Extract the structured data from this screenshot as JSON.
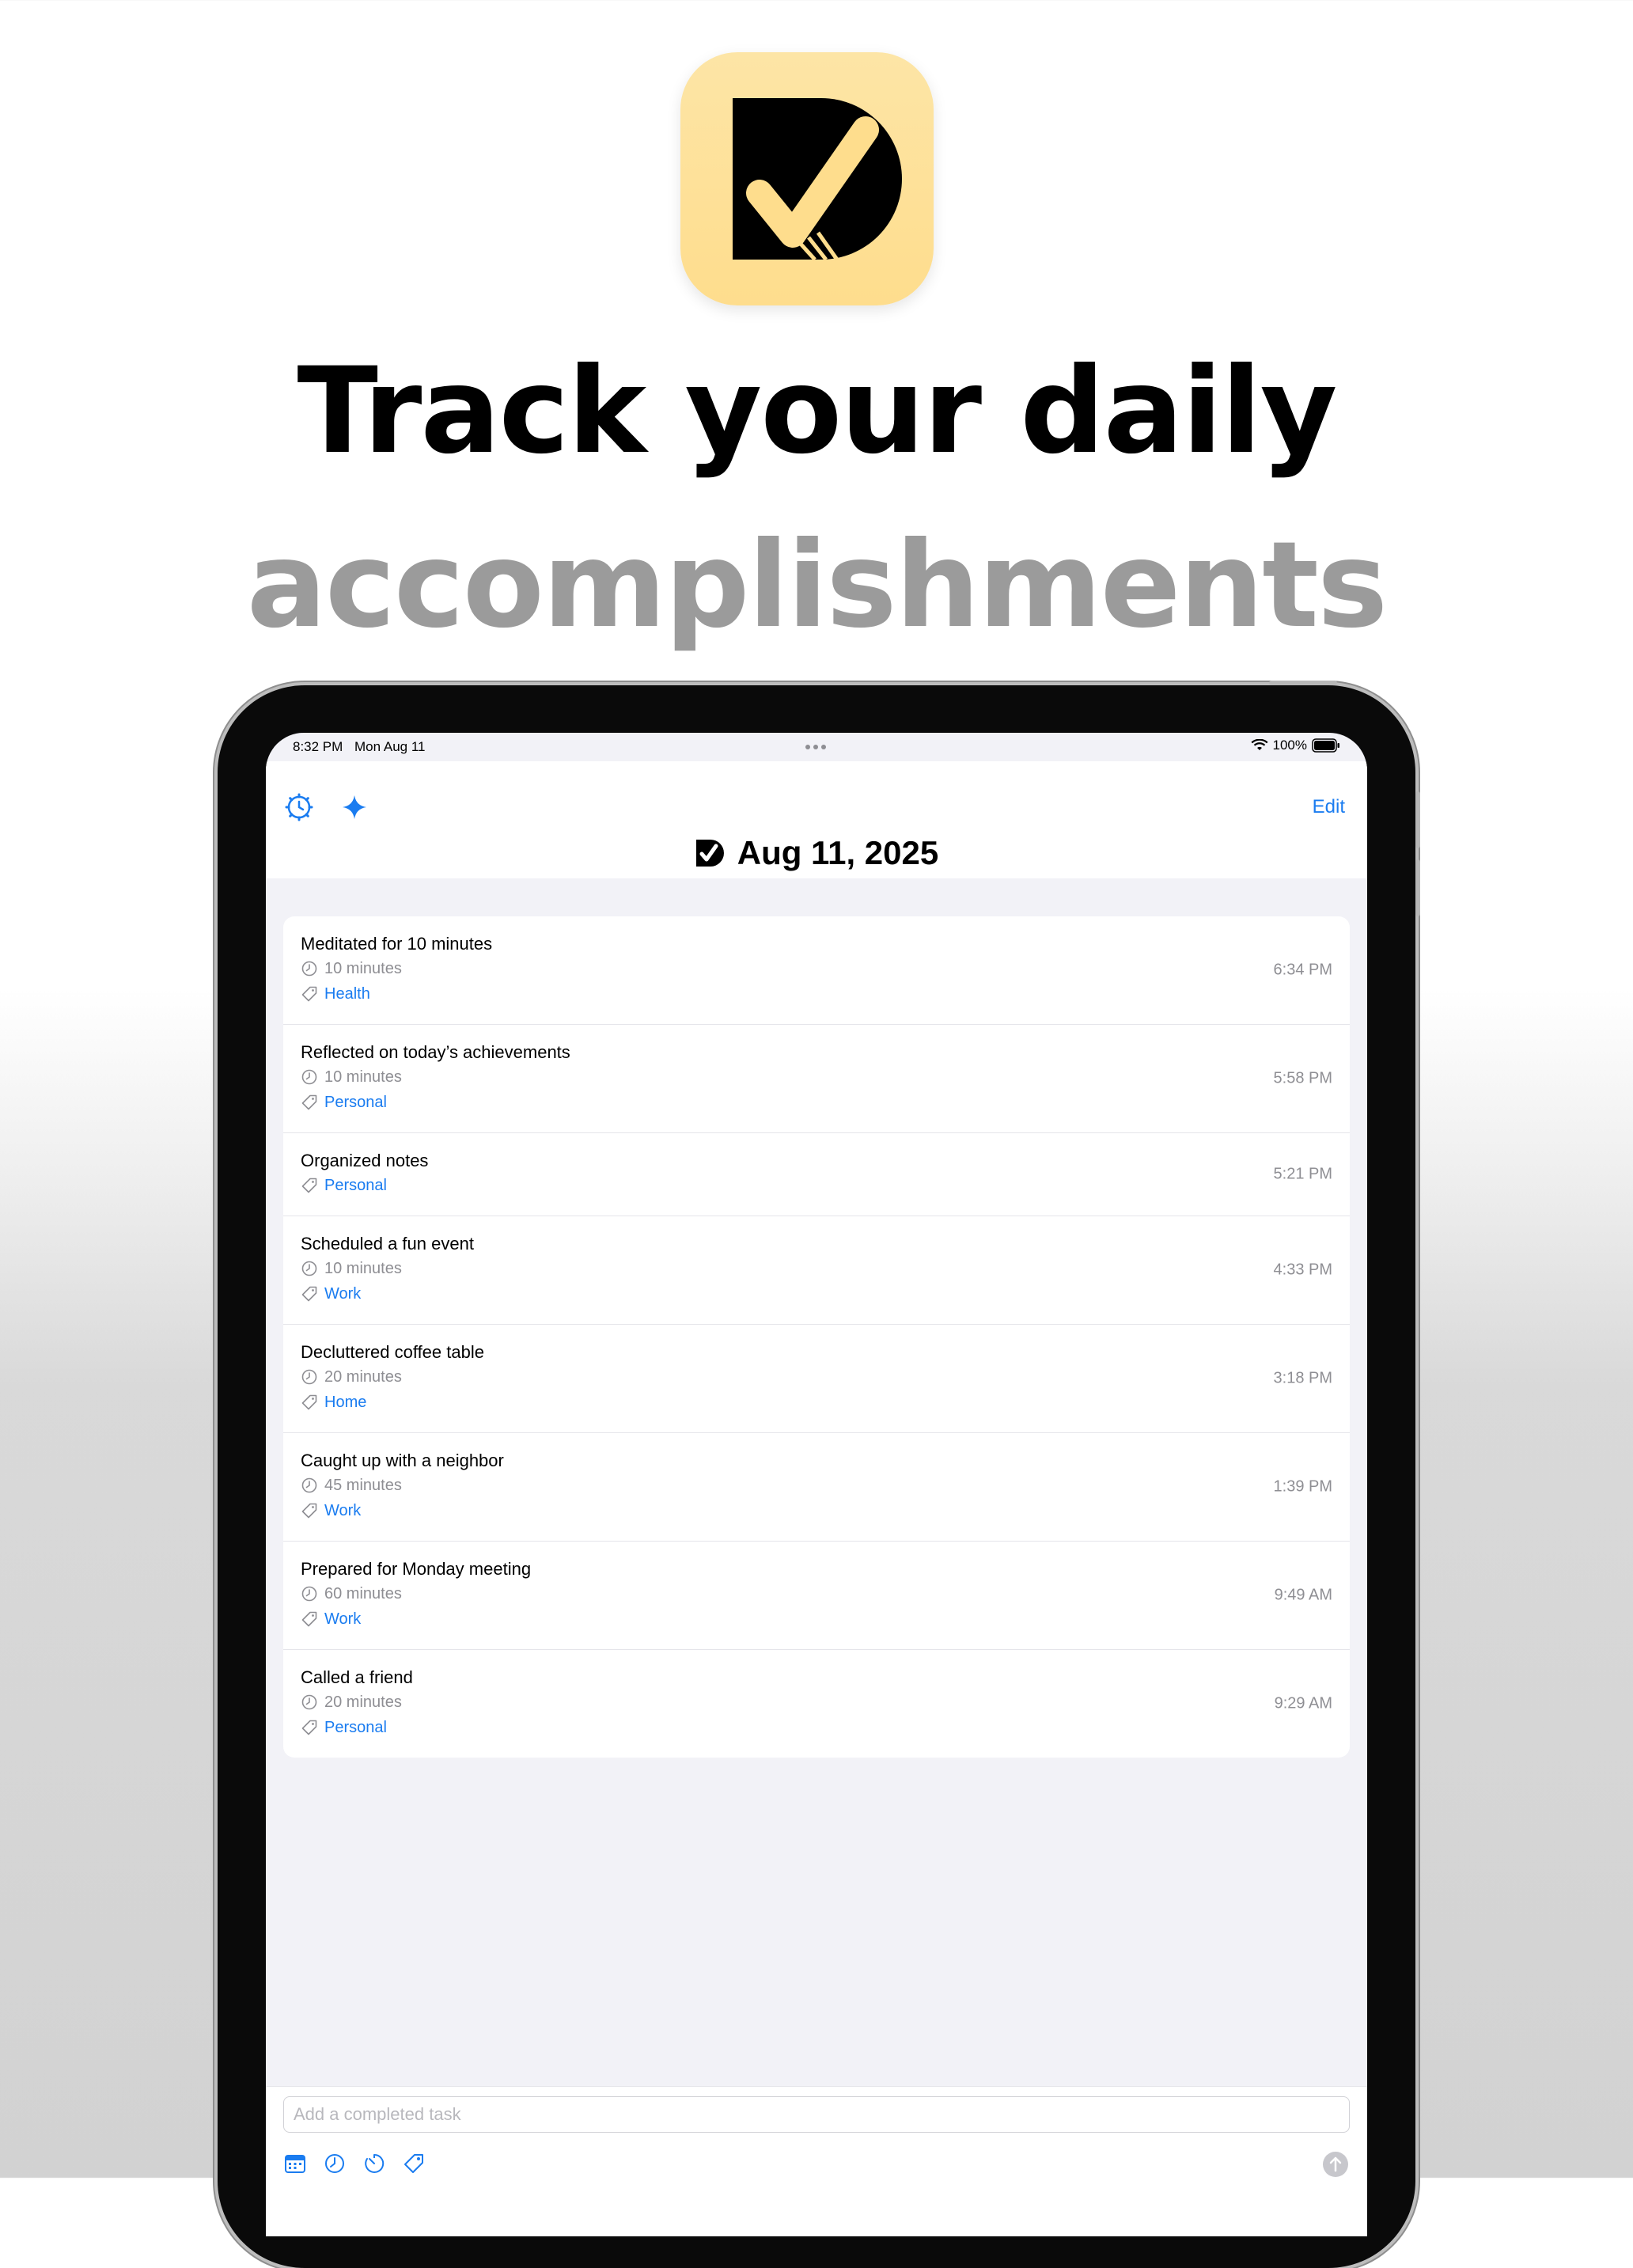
{
  "marketing": {
    "headline_line1": "Track your daily",
    "headline_line2": "accomplishments",
    "app_icon": "app-logo-d-checkmark"
  },
  "status_bar": {
    "time": "8:32 PM",
    "date": "Mon Aug 11",
    "battery": "100%"
  },
  "nav": {
    "settings_icon": "gear-clock-icon",
    "sparkle_icon": "sparkle-icon",
    "edit_label": "Edit",
    "title": "Aug 11, 2025"
  },
  "tasks": [
    {
      "title": "Meditated for 10 minutes",
      "duration": "10 minutes",
      "tag": "Health",
      "time": "6:34 PM"
    },
    {
      "title": "Reflected on today’s achievements",
      "duration": "10 minutes",
      "tag": "Personal",
      "time": "5:58 PM"
    },
    {
      "title": "Organized notes",
      "duration": "",
      "tag": "Personal",
      "time": "5:21 PM"
    },
    {
      "title": "Scheduled a fun event",
      "duration": "10 minutes",
      "tag": "Work",
      "time": "4:33 PM"
    },
    {
      "title": "Decluttered coffee table",
      "duration": "20 minutes",
      "tag": "Home",
      "time": "3:18 PM"
    },
    {
      "title": "Caught up with a neighbor",
      "duration": "45 minutes",
      "tag": "Work",
      "time": "1:39 PM"
    },
    {
      "title": "Prepared for Monday meeting",
      "duration": "60 minutes",
      "tag": "Work",
      "time": "9:49 AM"
    },
    {
      "title": "Called a friend",
      "duration": "20 minutes",
      "tag": "Personal",
      "time": "9:29 AM"
    }
  ],
  "composer": {
    "placeholder": "Add a completed task",
    "tools": [
      "calendar-icon",
      "clock-icon",
      "timer-icon",
      "tag-icon"
    ],
    "send_icon": "arrow-up-icon"
  },
  "colors": {
    "accent": "#1a7cf0",
    "icon_bg": "#fedd8d",
    "secondary_text": "#8e8e93",
    "headline_gray": "#9b9b9b"
  }
}
